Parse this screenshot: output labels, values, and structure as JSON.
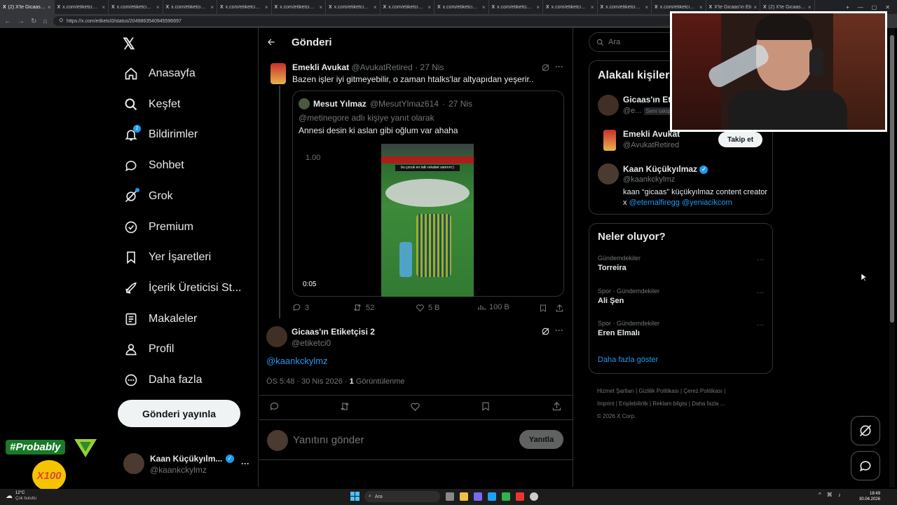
{
  "browser": {
    "tabs": [
      {
        "title": "(2) X'te Gicaas'ın E",
        "active": true
      },
      {
        "title": "x.com/etiketci0/sta",
        "active": false
      },
      {
        "title": "x.com/etiketci0/sta",
        "active": false
      },
      {
        "title": "x.com/etiketci0/sta",
        "active": false
      },
      {
        "title": "x.com/etiketci0/sta",
        "active": false
      },
      {
        "title": "x.com/etiketci0/sta",
        "active": false
      },
      {
        "title": "x.com/etiketci0/sta",
        "active": false
      },
      {
        "title": "x.com/etiketci0/sta",
        "active": false
      },
      {
        "title": "x.com/etiketci0/sta",
        "active": false
      },
      {
        "title": "x.com/etiketci0/sta",
        "active": false
      },
      {
        "title": "x.com/etiketci0/sta",
        "active": false
      },
      {
        "title": "x.com/etiketci0/sta",
        "active": false
      },
      {
        "title": "x.com/etiketci0/sta",
        "active": false
      },
      {
        "title": "X'te Gicaas'ın Eti",
        "active": false
      },
      {
        "title": "(2) X'te Gicaas'ın E",
        "active": false
      }
    ],
    "url": "https://x.com/etiketci0/status/2049863540945596697"
  },
  "sidebar": {
    "items": [
      {
        "label": "Anasayfa",
        "icon": "home-icon"
      },
      {
        "label": "Keşfet",
        "icon": "search-icon"
      },
      {
        "label": "Bildirimler",
        "icon": "bell-icon",
        "badge": "2"
      },
      {
        "label": "Sohbet",
        "icon": "chat-icon"
      },
      {
        "label": "Grok",
        "icon": "grok-icon"
      },
      {
        "label": "Premium",
        "icon": "premium-icon"
      },
      {
        "label": "Yer İşaretleri",
        "icon": "bookmark-icon"
      },
      {
        "label": "İçerik Üreticisi St...",
        "icon": "rocket-icon"
      },
      {
        "label": "Makaleler",
        "icon": "article-icon"
      },
      {
        "label": "Profil",
        "icon": "profile-icon"
      },
      {
        "label": "Daha fazla",
        "icon": "more-circle-icon"
      }
    ],
    "post_button": "Gönderi yayınla",
    "account": {
      "name": "Kaan Küçükyılm...",
      "handle": "@kaankckylmz",
      "more": "···"
    }
  },
  "main": {
    "header_title": "Gönderi",
    "parent_tweet": {
      "name": "Emekli Avukat",
      "handle": "@AvukatRetired",
      "sep": "·",
      "date": "27 Nis",
      "text": "Bazen işler iyi gitmeyebilir, o zaman htalks'lar altyapıdan yeşerir..",
      "quote": {
        "name": "Mesut Yılmaz",
        "handle": "@MesutYlmaz614",
        "sep": "·",
        "date": "27 Nis",
        "reply_to": "@metinegore adlı kişiye yanıt olarak",
        "text": "Annesi desin ki aslan gibi oğlum var ahaha",
        "video": {
          "time": "0:05",
          "speed": "1.00",
          "caption": "bu çocuk en tatlı rekabet sanırım:)"
        }
      },
      "stats": {
        "replies": "3",
        "reposts": "52",
        "likes": "5 B",
        "views": "100 B"
      }
    },
    "focal_tweet": {
      "name": "Gicaas'ın Etiketçisi 2",
      "handle": "@etiketci0",
      "text": "@kaankckylmz",
      "time": "ÖS 5:48 · 30 Nis 2026 ·",
      "views_count": "1",
      "views_label": "Görüntülenme"
    },
    "reply_box": {
      "placeholder": "Yanıtını gönder",
      "button": "Yanıtla"
    }
  },
  "right": {
    "search_placeholder": "Ara",
    "related_title": "Alakalı kişiler",
    "related": [
      {
        "name": "Gicaas'ın Eti",
        "handle": "@e...",
        "tag": "Seni takip..."
      },
      {
        "name": "Emekli Avukat",
        "handle": "@AvukatRetired",
        "follow": "Takip et"
      },
      {
        "name": "Kaan Küçükyılmaz",
        "handle": "@kaankckylmz",
        "bio_prefix": "kaan “gicaas” küçükyılmaz content creator x",
        "bio_link1": "@eternalfiregg",
        "bio_link2": "@yeniacikcom"
      }
    ],
    "trends_title": "Neler oluyor?",
    "trends": [
      {
        "category": "Gündemdekiler",
        "name": "Torreira"
      },
      {
        "category": "Spor · Gündemdekiler",
        "name": "Ali Şen"
      },
      {
        "category": "Spor · Gündemdekiler",
        "name": "Eren Elmalı"
      }
    ],
    "show_more": "Daha fazla göster",
    "footer_links": [
      "Hizmet Şartları",
      "Gizlilik Politikası",
      "Çerez Politikası",
      "Imprint",
      "Erişilebilirlik",
      "Reklam bilgisi",
      "Daha fazla ..."
    ],
    "copyright": "© 2026 X Corp."
  },
  "overlay": {
    "probably": "#Probably",
    "x100": "X100"
  },
  "taskbar": {
    "weather_temp": "12°C",
    "weather_desc": "Çok bulutlu",
    "search": "Ara",
    "time": "18:49",
    "date": "30.04.2026"
  },
  "colors": {
    "accent": "#1d9bf0",
    "background": "#000000",
    "border": "#2f3336",
    "muted": "#71767b"
  }
}
